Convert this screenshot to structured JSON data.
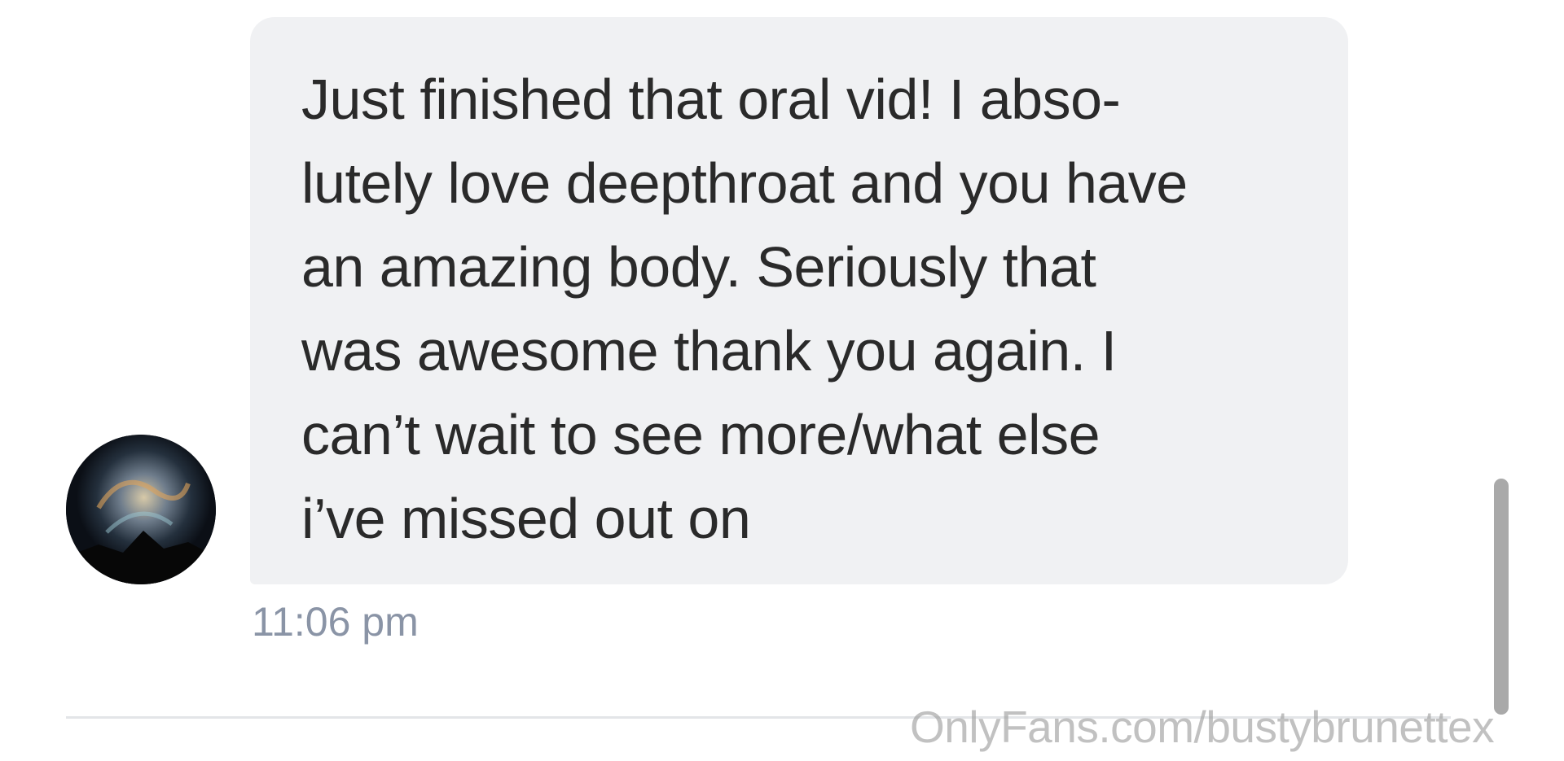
{
  "message": {
    "lines": [
      "Just finished that oral vid! I abso-",
      "lutely love deepthroat and you have",
      "an amazing body. Seriously that",
      "was awesome thank you again. I",
      "can’t wait to see more/what else",
      "i’ve missed out on"
    ],
    "timestamp": "11:06 pm"
  },
  "watermark": "OnlyFans.com/bustybrunettex",
  "colors": {
    "bubble": "#f0f1f3",
    "text": "#2a2a2a",
    "timestamp": "#8a94a6",
    "scrollbar": "#a9a9a9"
  },
  "icons": {
    "avatar": "avatar-image"
  }
}
